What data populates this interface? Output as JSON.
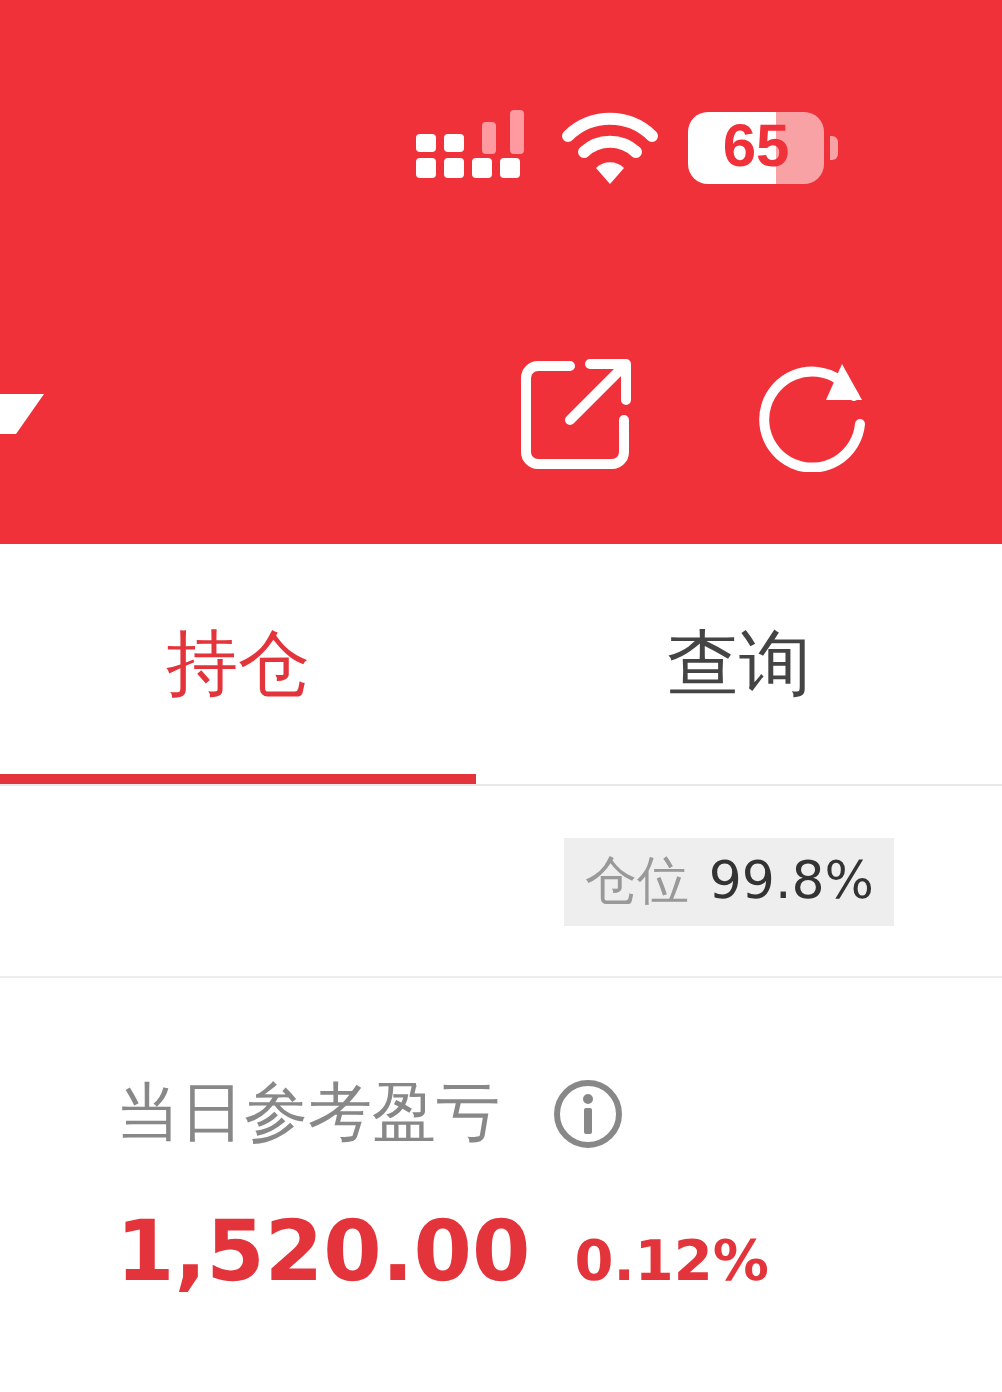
{
  "status_bar": {
    "battery": "65"
  },
  "tabs": [
    {
      "label": "持仓",
      "selected": true
    },
    {
      "label": "查询",
      "selected": false
    }
  ],
  "position": {
    "label": "仓位",
    "value": "99.8%"
  },
  "pnl": {
    "label": "当日参考盈亏",
    "amount": "1,520.00",
    "percent": "0.12%"
  }
}
